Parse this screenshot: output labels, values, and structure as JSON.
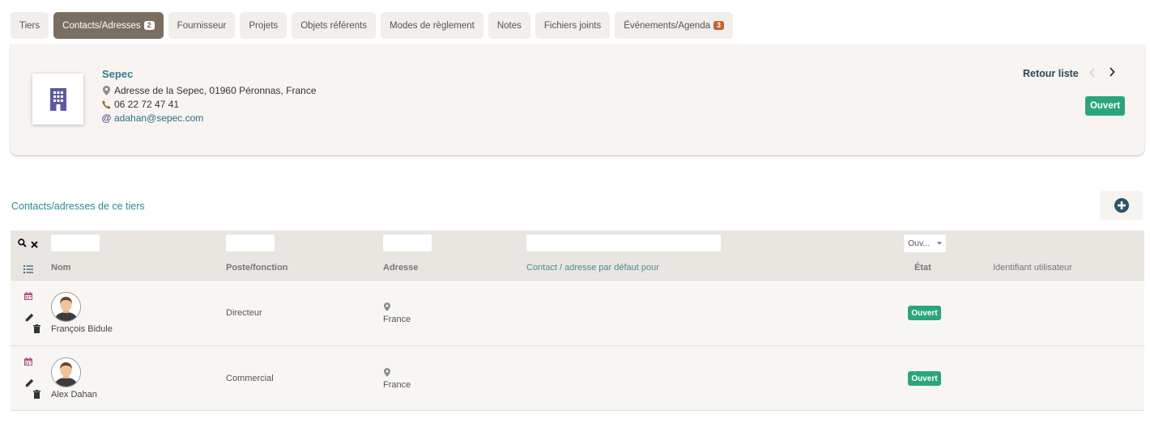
{
  "tabs": [
    {
      "label": "Tiers"
    },
    {
      "label": "Contacts/Adresses",
      "badge": "2",
      "active": true
    },
    {
      "label": "Fournisseur"
    },
    {
      "label": "Projets"
    },
    {
      "label": "Objets référents"
    },
    {
      "label": "Modes de règlement"
    },
    {
      "label": "Notes"
    },
    {
      "label": "Fichiers joints"
    },
    {
      "label": "Événements/Agenda",
      "badge": "3"
    }
  ],
  "thirdparty": {
    "name": "Sepec",
    "address": "Adresse de la Sepec, 01960 Péronnas, France",
    "phone": "06 22 72 47 41",
    "email": "adahan@sepec.com",
    "back_label": "Retour liste",
    "status": "Ouvert"
  },
  "section": {
    "title": "Contacts/adresses de ce tiers"
  },
  "filters": {
    "status_selected": "Ouv..."
  },
  "columns": {
    "name": "Nom",
    "position": "Poste/fonction",
    "address": "Adresse",
    "default_for": "Contact / adresse par défaut pour",
    "status": "État",
    "user_id": "Identifiant utilisateur"
  },
  "contacts": [
    {
      "name": "François Bidule",
      "position": "Directeur",
      "country": "France",
      "status": "Ouvert"
    },
    {
      "name": "Alex Dahan",
      "position": "Commercial",
      "country": "France",
      "status": "Ouvert"
    }
  ],
  "colors": {
    "accent": "#7a6e60",
    "status_green": "#2aa57d",
    "link": "#2b8a96",
    "badge_orange": "#c6602e"
  }
}
